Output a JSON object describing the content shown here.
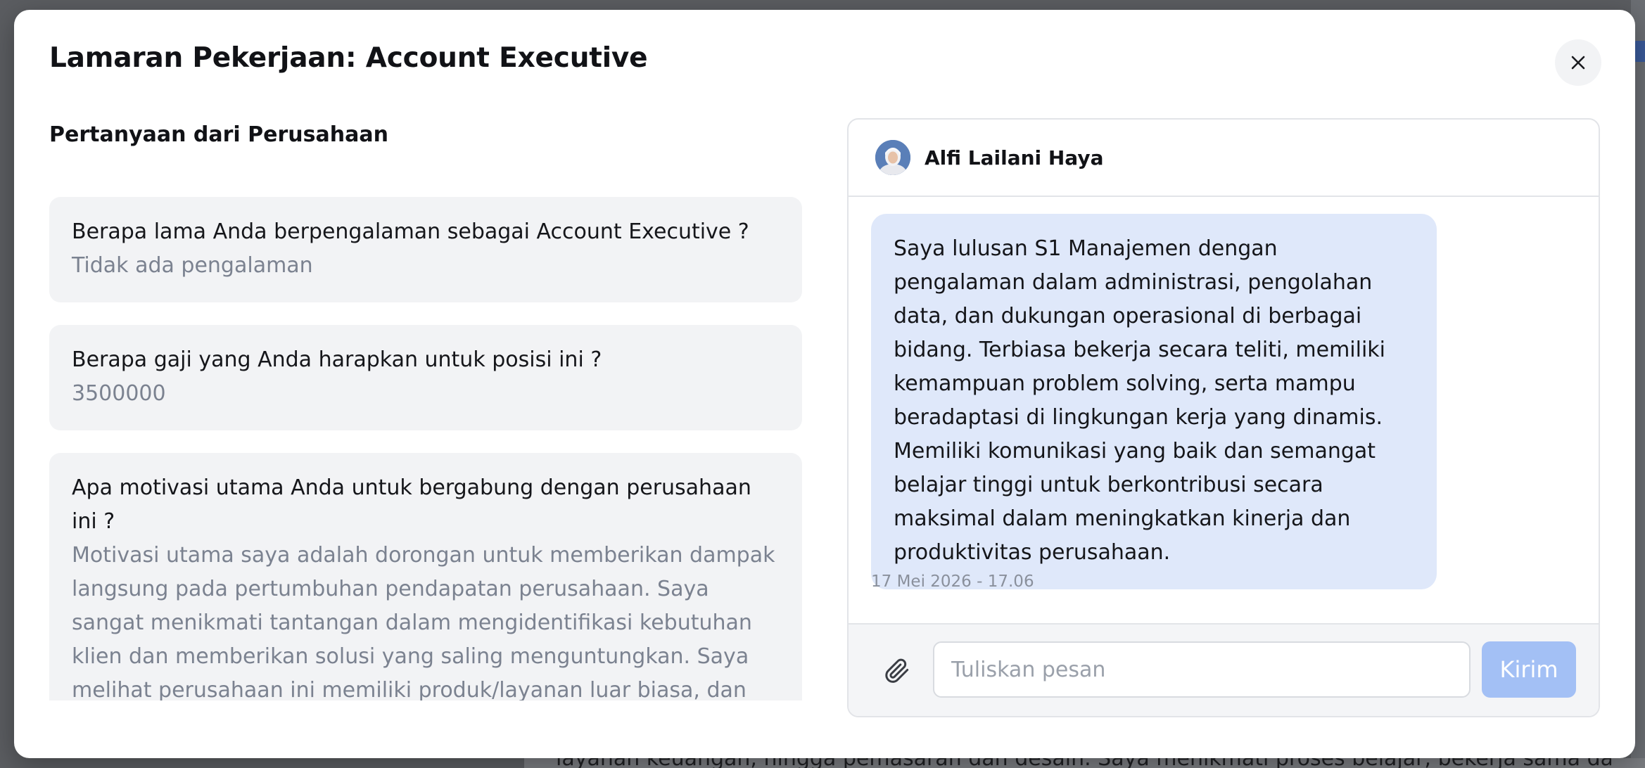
{
  "background": {
    "bottom_text": "layanan keuangan, hingga pemasaran dan desain. Saya menikmati proses belajar, bekerja sama dalam"
  },
  "modal": {
    "title": "Lamaran Pekerjaan: Account Executive",
    "close_icon": "close-icon"
  },
  "questions": {
    "section_title": "Pertanyaan dari Perusahaan",
    "items": [
      {
        "question": "Berapa lama Anda berpengalaman sebagai Account Executive ?",
        "answer": "Tidak ada pengalaman"
      },
      {
        "question": "Berapa gaji yang Anda harapkan untuk posisi ini ?",
        "answer": "3500000"
      },
      {
        "question": "Apa motivasi utama Anda untuk bergabung dengan perusahaan ini ?",
        "answer": "Motivasi utama saya adalah dorongan untuk memberikan dampak langsung pada pertumbuhan pendapatan perusahaan. Saya sangat menikmati tantangan dalam mengidentifikasi kebutuhan klien dan memberikan solusi yang saling menguntungkan. Saya melihat perusahaan ini memiliki produk/layanan luar biasa, dan saya ingin menggunakan kemampuan closing serta negosiasi saya untuk"
      }
    ]
  },
  "chat": {
    "contact_name": "Alfi Lailani Haya",
    "message_text": "Saya lulusan S1 Manajemen dengan pengalaman dalam administrasi, pengolahan data, dan dukungan operasional di berbagai bidang. Terbiasa bekerja secara teliti, memiliki kemampuan problem solving, serta mampu beradaptasi di lingkungan kerja yang dinamis. Memiliki komunikasi yang baik dan semangat belajar tinggi untuk berkontribusi secara maksimal dalam meningkatkan kinerja dan produktivitas perusahaan.",
    "message_time": "17 Mei 2026 - 17.06",
    "input_placeholder": "Tuliskan pesan",
    "input_value": "",
    "send_label": "Kirim",
    "attach_icon": "paperclip-icon"
  },
  "colors": {
    "bubble": "#dfe8fa",
    "send_button": "#a3c0f5",
    "card": "#f2f3f5",
    "answer_text": "#7b8290"
  }
}
